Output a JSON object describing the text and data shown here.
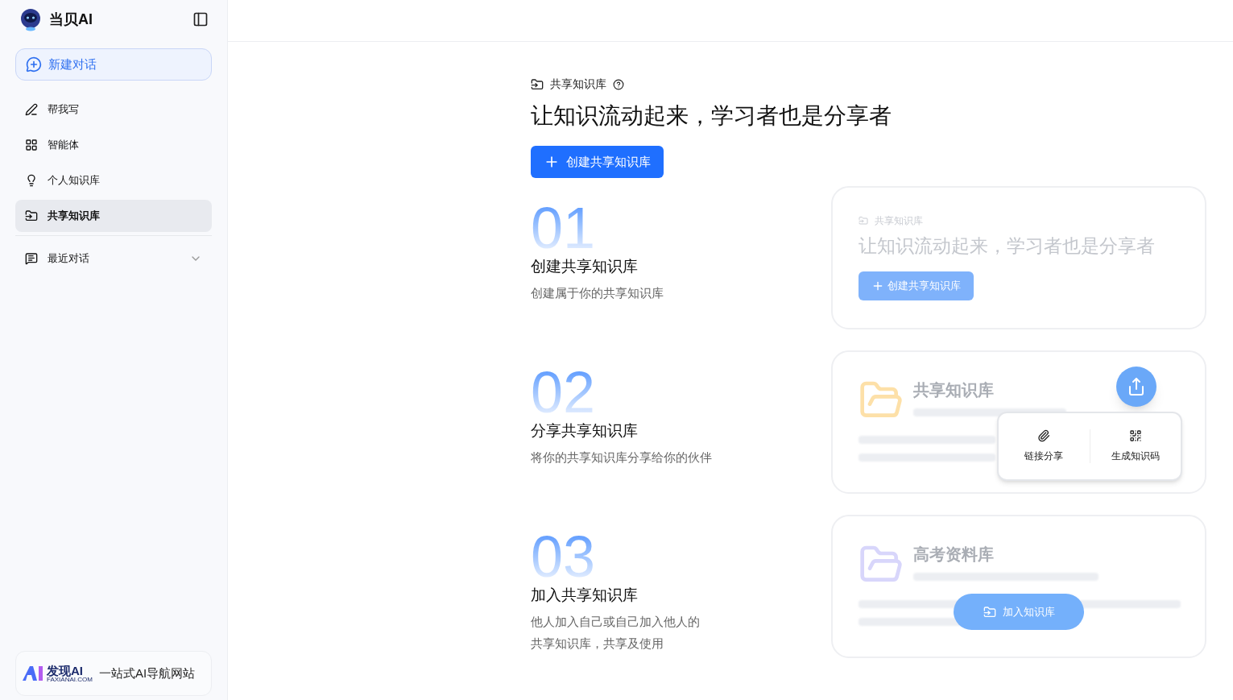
{
  "sidebar": {
    "logo": "当贝AI",
    "new_chat": "新建对话",
    "items": [
      {
        "label": "帮我写",
        "kind": "write",
        "selected": false
      },
      {
        "label": "智能体",
        "kind": "agent",
        "selected": false
      },
      {
        "label": "个人知识库",
        "kind": "personal",
        "selected": false
      },
      {
        "label": "共享知识库",
        "kind": "shared",
        "selected": true
      }
    ],
    "recent": {
      "label": "最近对话",
      "expanded": false
    },
    "footer": {
      "brand": "发现AI",
      "brand_sub": "FAXIANAI.COM",
      "tagline": "一站式AI导航网站"
    }
  },
  "header": {
    "label": "共享知识库",
    "title": "让知识流动起来，学习者也是分享者",
    "create_button": "创建共享知识库"
  },
  "steps": [
    {
      "number": "01",
      "title": "创建共享知识库",
      "desc_lines": [
        "创建属于你的共享知识库"
      ],
      "card": {
        "kind": "create",
        "label": "共享知识库",
        "title": "让知识流动起来，学习者也是分享者",
        "button": "创建共享知识库"
      }
    },
    {
      "number": "02",
      "title": "分享共享知识库",
      "desc_lines": [
        "将你的共享知识库分享给你的伙伴"
      ],
      "card": {
        "kind": "share",
        "title": "共享知识库",
        "options": [
          "链接分享",
          "生成知识码"
        ]
      }
    },
    {
      "number": "03",
      "title": "加入共享知识库",
      "desc_lines": [
        "他人加入自己或自己加入他人的",
        "共享知识库，共享及使用"
      ],
      "card": {
        "kind": "join",
        "title": "高考资料库",
        "button": "加入知识库"
      }
    }
  ]
}
